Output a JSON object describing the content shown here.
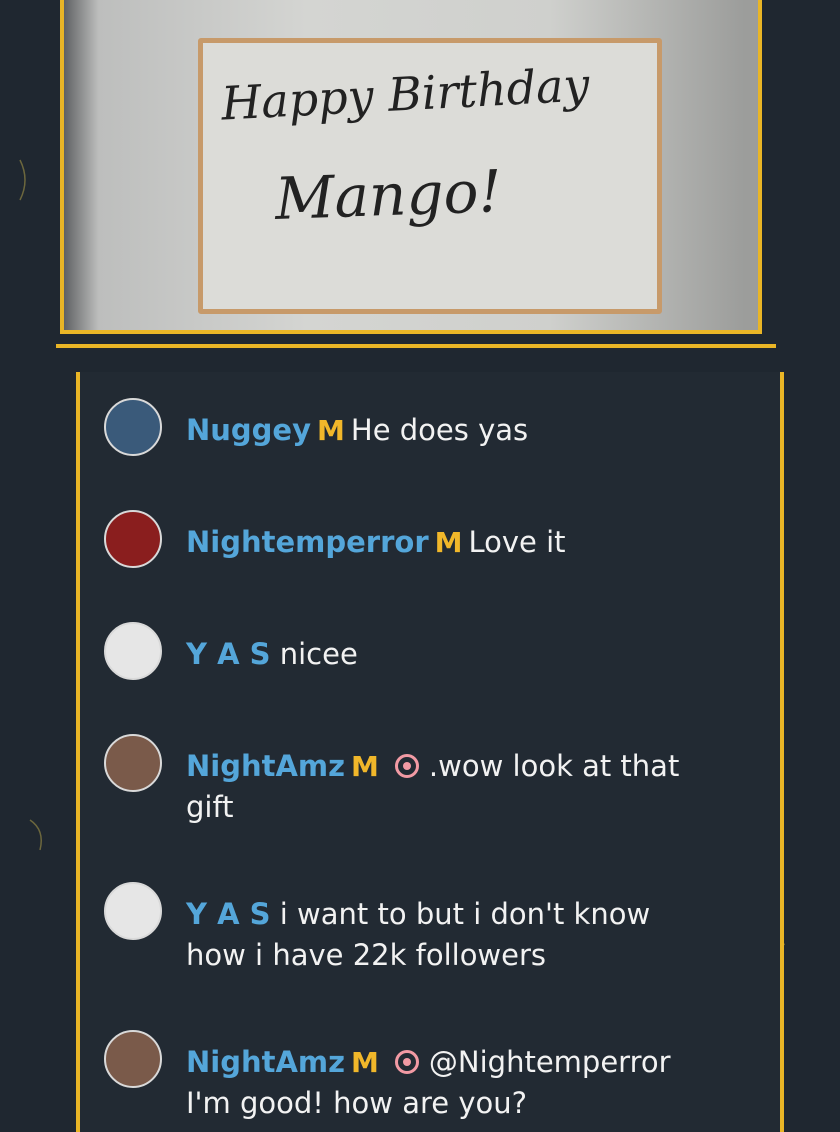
{
  "video": {
    "board_line1": "Happy Birthday",
    "board_line2": "Mango!"
  },
  "messages": [
    {
      "user": "Nuggey",
      "badge": "M",
      "text": "He does yas",
      "cont": "",
      "avatar_color": "#3a5a7a"
    },
    {
      "user": "Nightemperror",
      "badge": "M",
      "text": "Love it",
      "cont": "",
      "avatar_color": "#8a1e1e"
    },
    {
      "user": "Y A S",
      "badge": "",
      "text": "nicee",
      "cont": "",
      "avatar_color": "#e6e6e6"
    },
    {
      "user": "NightAmz",
      "badge": "M",
      "text": ".wow look at that",
      "cont": "gift",
      "avatar_color": "#7a5a4a"
    },
    {
      "user": "Y A S",
      "badge": "",
      "text": "i want to but i don't know",
      "cont": "how i have 22k followers",
      "avatar_color": "#e6e6e6"
    },
    {
      "user": "NightAmz",
      "badge": "M",
      "text": "@Nightemperror",
      "cont": "I'm good! how are you?",
      "avatar_color": "#7a5a4a"
    }
  ],
  "colors": {
    "accent": "#e9b526",
    "username": "#54a6da",
    "badge_m": "#f1b72a",
    "badge_o": "#f29aa4",
    "background": "#1f2730"
  }
}
